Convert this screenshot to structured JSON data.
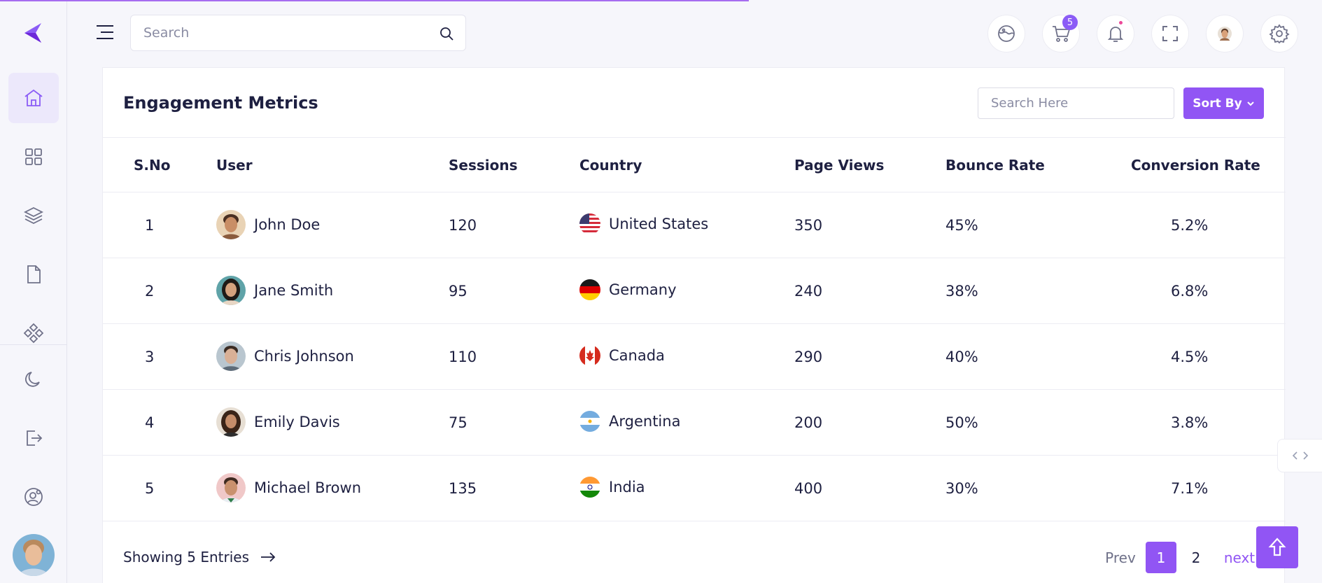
{
  "header": {
    "search_placeholder": "Search",
    "cart_count": "5"
  },
  "sidebar": {
    "items": [
      {
        "icon": "home-icon",
        "active": true
      },
      {
        "icon": "grid-icon"
      },
      {
        "icon": "layers-icon"
      },
      {
        "icon": "file-icon"
      },
      {
        "icon": "components-icon"
      },
      {
        "icon": "moon-icon"
      },
      {
        "icon": "logout-icon"
      },
      {
        "icon": "user-settings-icon"
      }
    ]
  },
  "card": {
    "title": "Engagement Metrics",
    "search_placeholder": "Search Here",
    "sort_label": "Sort By"
  },
  "table": {
    "columns": [
      "S.No",
      "User",
      "Sessions",
      "Country",
      "Page Views",
      "Bounce Rate",
      "Conversion Rate"
    ],
    "rows": [
      {
        "sno": "1",
        "user": "John Doe",
        "sessions": "120",
        "country": "United States",
        "page_views": "350",
        "bounce_rate": "45%",
        "conversion_rate": "5.2%"
      },
      {
        "sno": "2",
        "user": "Jane Smith",
        "sessions": "95",
        "country": "Germany",
        "page_views": "240",
        "bounce_rate": "38%",
        "conversion_rate": "6.8%"
      },
      {
        "sno": "3",
        "user": "Chris Johnson",
        "sessions": "110",
        "country": "Canada",
        "page_views": "290",
        "bounce_rate": "40%",
        "conversion_rate": "4.5%"
      },
      {
        "sno": "4",
        "user": "Emily Davis",
        "sessions": "75",
        "country": "Argentina",
        "page_views": "200",
        "bounce_rate": "50%",
        "conversion_rate": "3.8%"
      },
      {
        "sno": "5",
        "user": "Michael Brown",
        "sessions": "135",
        "country": "India",
        "page_views": "400",
        "bounce_rate": "30%",
        "conversion_rate": "7.1%"
      }
    ]
  },
  "footer": {
    "showing_text": "Showing 5 Entries",
    "prev": "Prev",
    "page1": "1",
    "page2": "2",
    "next": "next"
  },
  "colors": {
    "accent": "#9155f4",
    "text": "#1e2041",
    "badge_pink": "#ec4899"
  }
}
